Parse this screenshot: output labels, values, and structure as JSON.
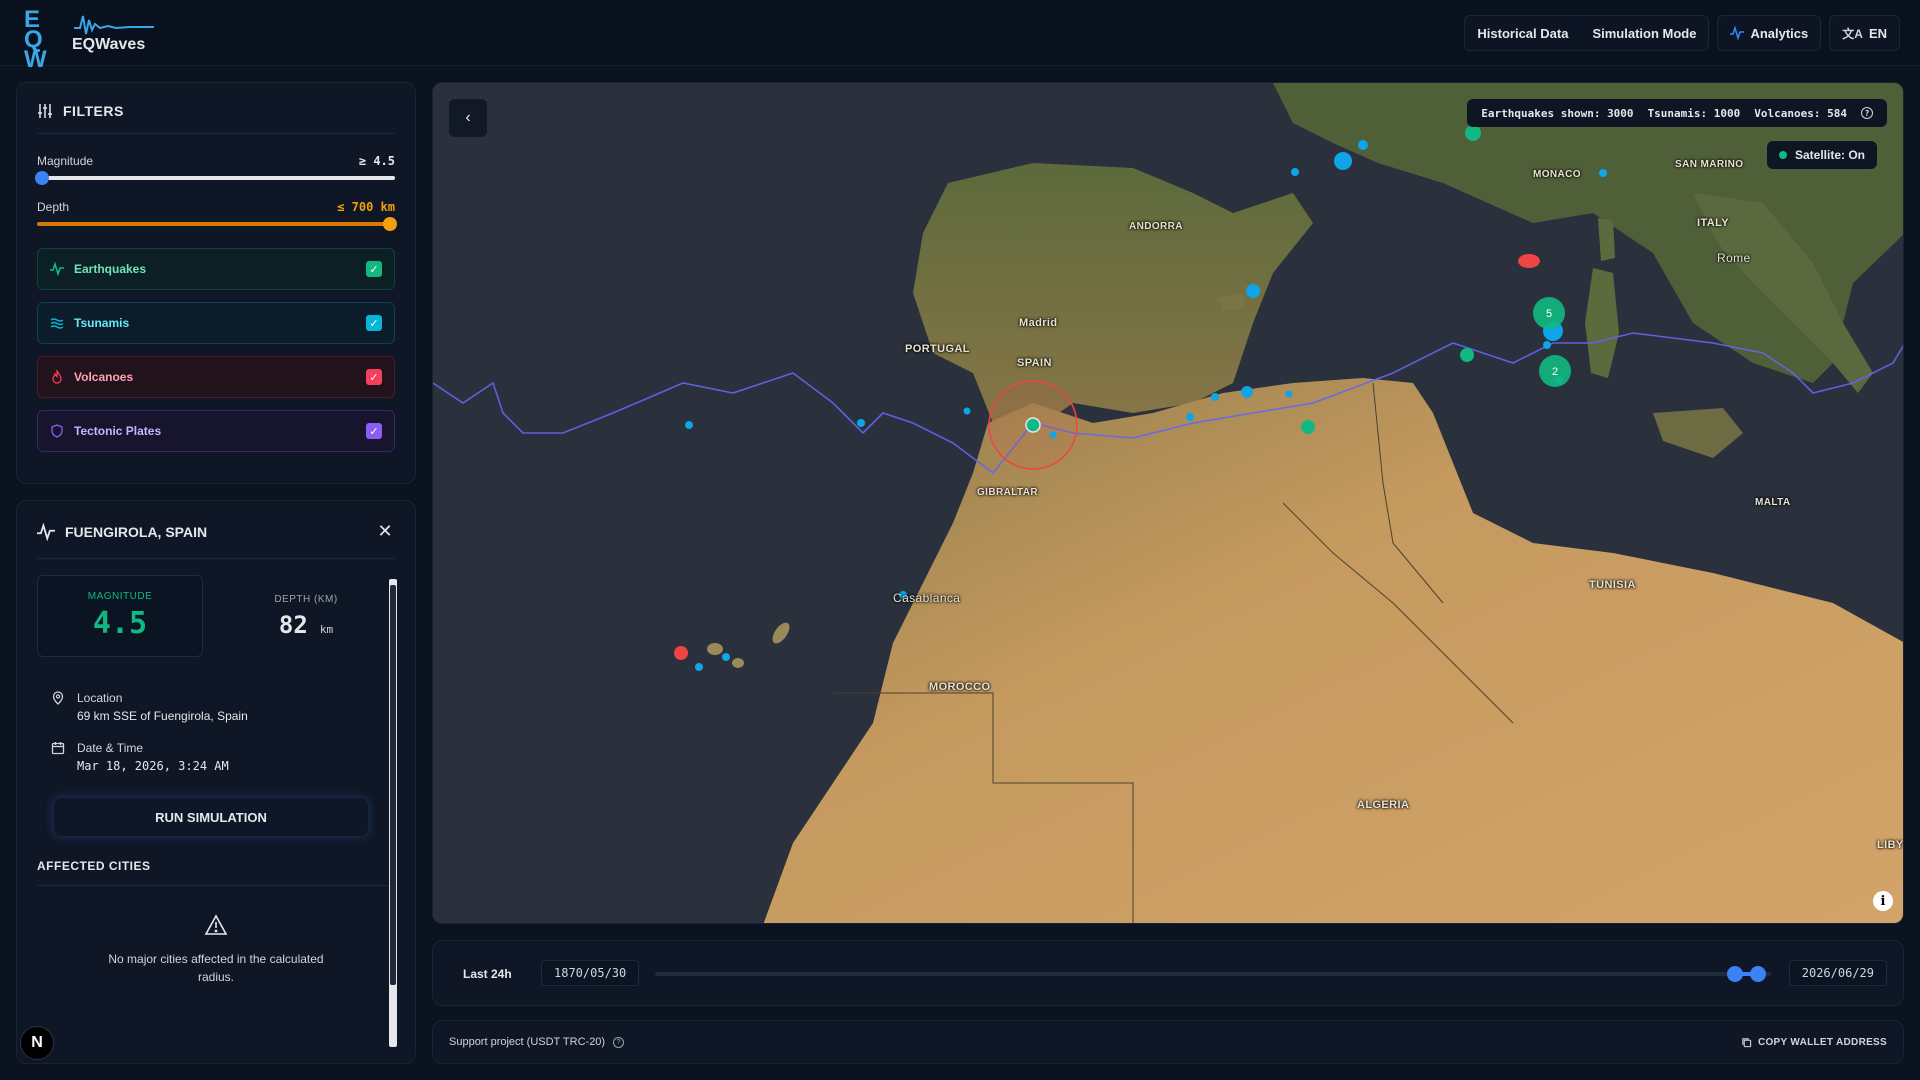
{
  "header": {
    "logo_mark": "EQ W",
    "logo_name": "EQWaves",
    "nav": {
      "historical": "Historical Data",
      "simulation": "Simulation Mode",
      "analytics": "Analytics",
      "language": "EN"
    }
  },
  "filters": {
    "title": "FILTERS",
    "magnitude": {
      "label": "Magnitude",
      "value": "≥ 4.5",
      "fraction": 0.0
    },
    "depth": {
      "label": "Depth",
      "value": "≤ 700 km",
      "fraction": 1.0
    },
    "layers": [
      {
        "label": "Earthquakes",
        "checked": true,
        "color": "#10b981"
      },
      {
        "label": "Tsunamis",
        "checked": true,
        "color": "#06b6d4"
      },
      {
        "label": "Volcanoes",
        "checked": true,
        "color": "#f43f5e"
      },
      {
        "label": "Tectonic Plates",
        "checked": true,
        "color": "#8b5cf6"
      }
    ]
  },
  "detail": {
    "title": "FUENGIROLA, SPAIN",
    "magnitude_label": "MAGNITUDE",
    "magnitude_value": "4.5",
    "depth_label": "DEPTH (KM)",
    "depth_value": "82",
    "depth_unit": "km",
    "location_label": "Location",
    "location_value": "69 km SSE of Fuengirola, Spain",
    "datetime_label": "Date & Time",
    "datetime_value": "Mar 18, 2026, 3:24 AM",
    "run_button": "RUN SIMULATION",
    "affected_title": "AFFECTED CITIES",
    "affected_empty": "No major cities affected in the calculated radius."
  },
  "map": {
    "counts": {
      "earthquakes": "Earthquakes shown: 3000",
      "tsunamis": "Tsunamis: 1000",
      "volcanoes": "Volcanoes: 584"
    },
    "satellite": "Satellite: On",
    "labels": {
      "andorra": "ANDORRA",
      "madrid": "Madrid",
      "portugal": "PORTUGAL",
      "spain": "SPAIN",
      "gibraltar": "GIBRALTAR",
      "casablanca": "Casablanca",
      "morocco": "MOROCCO",
      "algeria": "ALGERIA",
      "tunisia": "TUNISIA",
      "malta": "MALTA",
      "italy": "ITALY",
      "rome": "Rome",
      "san_marino": "SAN MARINO",
      "monaco": "MONACO",
      "libya": "LIBY"
    },
    "clusters": {
      "a": "5",
      "b": "2"
    },
    "colors": {
      "earthquake": "#10b981",
      "tsunami": "#06b6d4",
      "volcano": "#ef4444",
      "plate": "#6366f1"
    }
  },
  "timeline": {
    "range": "Last 24h",
    "start": "1870/05/30",
    "end": "2026/06/29",
    "from_fraction": 0.968,
    "to_fraction": 0.988
  },
  "footer": {
    "support": "Support project (USDT TRC-20)",
    "copy": "COPY WALLET ADDRESS"
  }
}
